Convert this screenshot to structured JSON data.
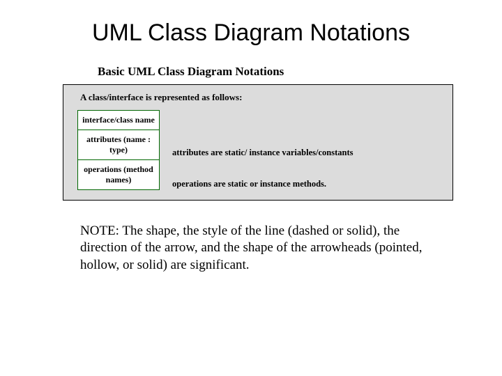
{
  "title": "UML Class Diagram Notations",
  "figure": {
    "heading": "Basic UML Class Diagram Notations",
    "intro": "A class/interface is represented as follows:",
    "classbox": {
      "name": "interface/class name",
      "attributes": "attributes (name : type)",
      "operations": "operations (method names)"
    },
    "labels": {
      "attributes": "attributes are static/ instance variables/constants",
      "operations": "operations are static or instance methods."
    }
  },
  "note": "NOTE: The shape, the style of the line (dashed or solid), the direction of the arrow, and the shape of the arrowheads (pointed, hollow, or solid) are significant."
}
